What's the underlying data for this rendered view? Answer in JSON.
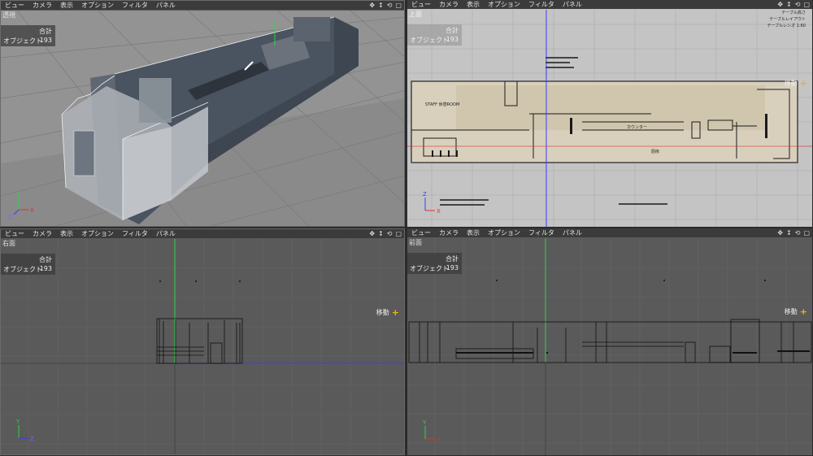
{
  "menu": [
    "ビュー",
    "カメラ",
    "表示",
    "オプション",
    "フィルタ",
    "パネル"
  ],
  "hud": {
    "total_label": "合計",
    "objects_label": "オブジェクト",
    "objects_count": "193"
  },
  "move_label": "移動",
  "axis": {
    "x": "X",
    "y": "Y",
    "z": "Z"
  },
  "viewports": {
    "perspective": {
      "name": "透視"
    },
    "top": {
      "name": "上面"
    },
    "right": {
      "name": "右面"
    },
    "front": {
      "name": "前面"
    }
  },
  "top_view_labels": {
    "legend_a": "テーブル高さ",
    "legend_b": "テーブルレイアウト",
    "legend_c": "テーブルレシオ 1:60",
    "label_staff": "STAFF 休憩ROOM",
    "label_counter": "カウンター",
    "label_kitchen": "厨房"
  },
  "colors": {
    "viewport_bg": "#5a5a5a",
    "top_bg": "#c8c8c8",
    "accent_green": "#33d04a",
    "accent_blue": "#3a3aff",
    "accent_red": "#e03030",
    "move_plus": "#f2b300"
  }
}
